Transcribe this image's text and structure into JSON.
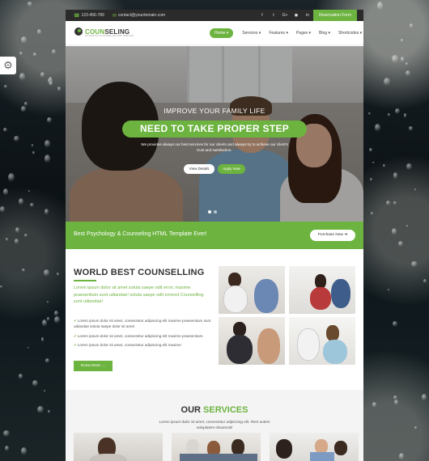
{
  "settings": {
    "icon": "gear-icon"
  },
  "topbar": {
    "phone": "123-456-789",
    "email": "contact@yourdomain.com",
    "socials": [
      "f",
      "t",
      "G+",
      "◼",
      "in"
    ],
    "reserve_label": "Reservation Form"
  },
  "header": {
    "logo_prefix": "COUN",
    "logo_suffix": "SELING",
    "logo_tagline": "PSYCHOLOGY & COUNSELLING HTML TEMPLATE",
    "nav": [
      "Home ▾",
      "Services ▾",
      "Features ▾",
      "Pages ▾",
      "Blog ▾",
      "Shortcodes ▾"
    ]
  },
  "hero": {
    "subtitle": "Improve your family life",
    "title": "NEED TO TAKE PROPER STEP",
    "description": "We provides always our best services for our clients and always try to achieve our client's trust and satisfaction.",
    "view_label": "View Details",
    "apply_label": "Apply Now"
  },
  "cta": {
    "text": "Best Psychology & Counseling HTML Template Ever!",
    "button_label": "Purchase Now ➜"
  },
  "about": {
    "title": "WORLD BEST COUNSELLING",
    "lead": "Lorem ipsum dolor sit amet soluta saepe odit error, maxime praesentium sunt udiandae! soluta saepe odit errored Counselling sunt udiandae!",
    "checks": [
      "Lorem ipsum dolor sit amet, consectetur adipiscing elit maxime praesentium sunt udiandae soluta saepe dolor sit amet",
      "Lorem ipsum dolor sit amet, consectetur adipiscing elit maxime praesentium.",
      "Lorem ipsum dolor sit amet, consectetur adipiscing elit maxime"
    ],
    "button_label": "Know More →"
  },
  "services": {
    "title_prefix": "OUR ",
    "title_suffix": "SERVICES",
    "description": "Lorem ipsum dolor sit amet, consectetur adipiscing elit. Rem autem voluptatem obcaecati!"
  },
  "colors": {
    "accent": "#6cb33f",
    "topbar": "#2b2b2b"
  }
}
